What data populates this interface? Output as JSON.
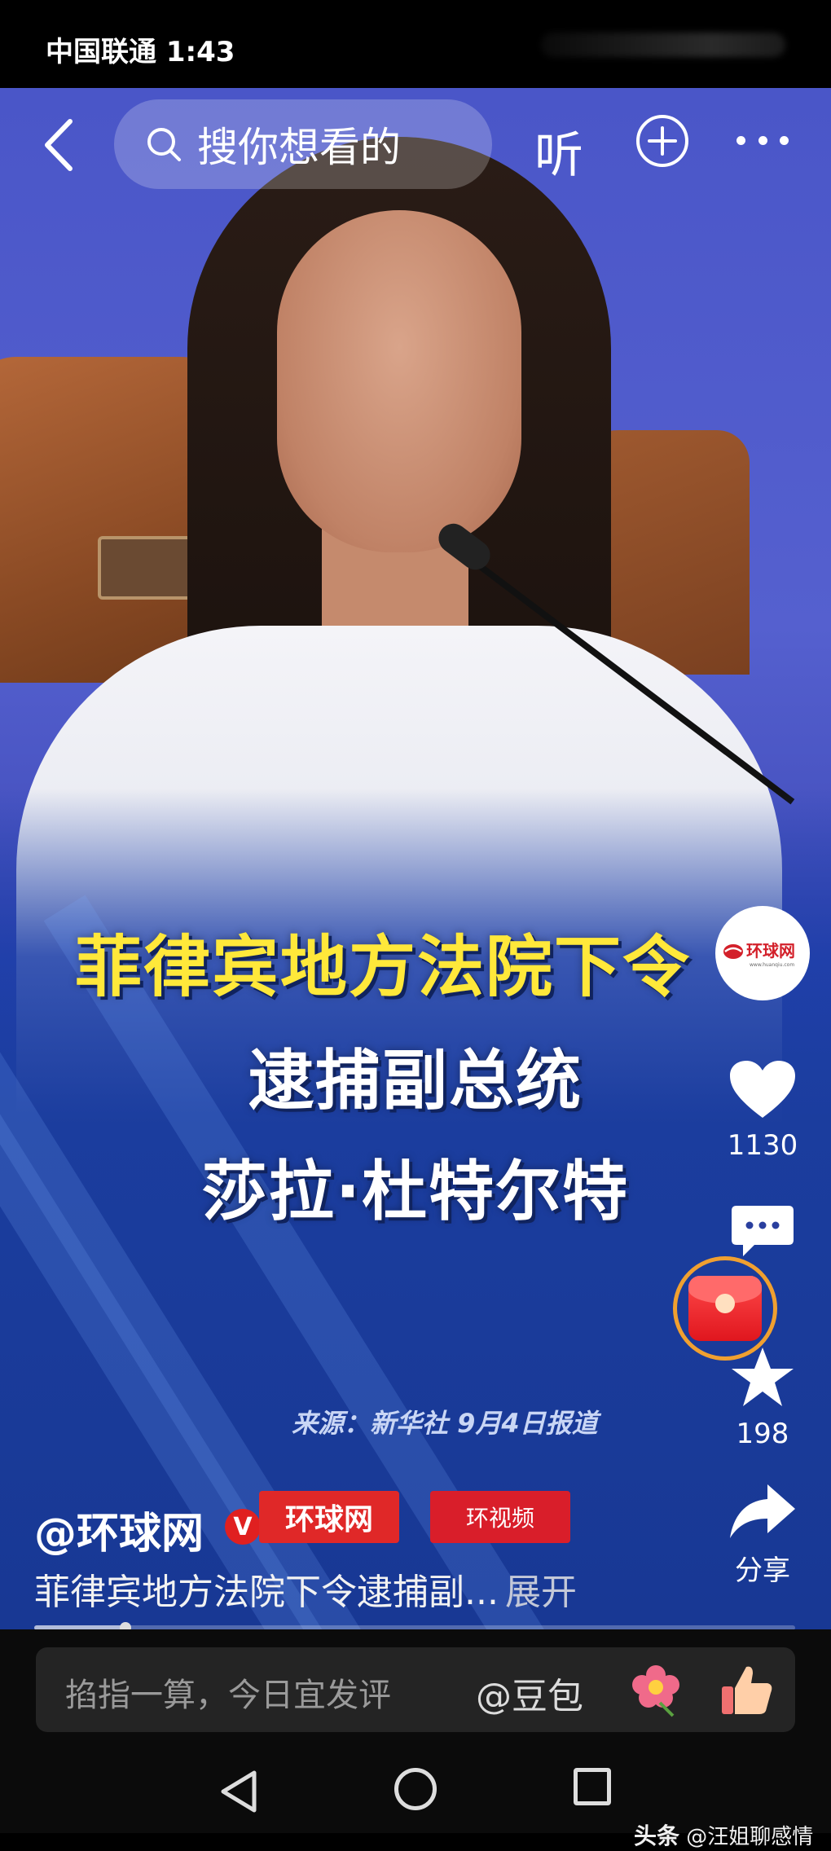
{
  "status_bar": {
    "carrier_time": "中国联通 1:43"
  },
  "top_bar": {
    "search_placeholder": "搜你想看的",
    "listen_label": "听"
  },
  "video": {
    "headline_lines": [
      "菲律宾地方法院下令",
      "逮捕副总统",
      "莎拉·杜特尔特"
    ],
    "source": "来源：新华社 9月4日报道",
    "brand_logo_text": "环球网",
    "brand_logo_url_text": "www.huanqiu.com",
    "logo_huanqiu": "环球网",
    "logo_huanshipin": "环视频"
  },
  "actions": {
    "like_count": "1130",
    "favorite_count": "198",
    "share_label": "分享"
  },
  "author": {
    "name": "@环球网",
    "verified_badge": "V"
  },
  "description": {
    "text": "菲律宾地方法院下令逮捕副...",
    "expand_label": "展开"
  },
  "progress": {
    "fraction": 0.12
  },
  "comment_bar": {
    "placeholder": "掐指一算，今日宜发评",
    "mention": "@豆包"
  },
  "watermark": {
    "app": "头条",
    "user": "@汪姐聊感情"
  },
  "colors": {
    "headline_yellow": "#ffe83a",
    "brand_red": "#e02828",
    "highlight_ring": "#f0a030"
  }
}
